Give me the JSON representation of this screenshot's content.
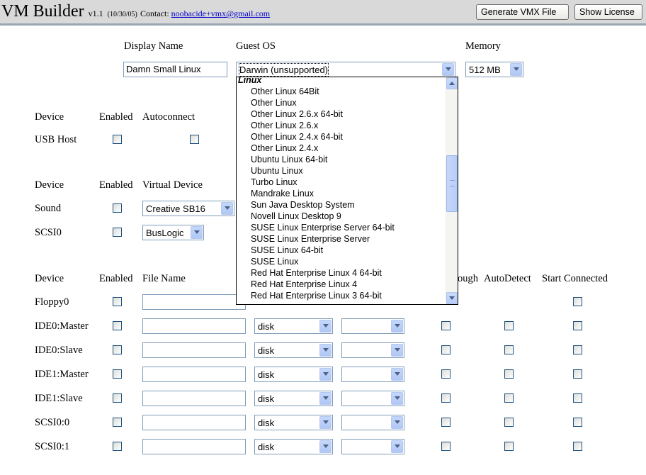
{
  "header": {
    "title": "VM Builder",
    "version": "v1.1",
    "date": "(10/30/05)",
    "contact_label": "Contact:",
    "contact_email": "noobacide+vmx@gmail.com",
    "generate_button": "Generate VMX File",
    "license_button": "Show License"
  },
  "general": {
    "display_name_label": "Display Name",
    "guest_os_label": "Guest OS",
    "memory_label": "Memory",
    "display_name_value": "Damn Small Linux",
    "guest_os_value": "Darwin (unsupported)",
    "memory_value": "512 MB"
  },
  "guest_os_dropdown": {
    "group": "Linux",
    "items": [
      "Other Linux 64Bit",
      "Other Linux",
      "Other Linux 2.6.x 64-bit",
      "Other Linux 2.6.x",
      "Other Linux 2.4.x 64-bit",
      "Other Linux 2.4.x",
      "Ubuntu Linux 64-bit",
      "Ubuntu Linux",
      "Turbo Linux",
      "Mandrake Linux",
      "Sun Java Desktop System",
      "Novell Linux Desktop 9",
      "SUSE Linux Enterprise Server 64-bit",
      "SUSE Linux Enterprise Server",
      "SUSE Linux 64-bit",
      "SUSE Linux",
      "Red Hat Enterprise Linux 4 64-bit",
      "Red Hat Enterprise Linux 4",
      "Red Hat Enterprise Linux 3 64-bit"
    ]
  },
  "usb_section": {
    "device_header": "Device",
    "enabled_header": "Enabled",
    "autoconnect_header": "Autoconnect",
    "row_label": "USB Host"
  },
  "virtual_section": {
    "device_header": "Device",
    "enabled_header": "Enabled",
    "virtual_device_header": "Virtual Device",
    "rows": [
      {
        "label": "Sound",
        "value": "Creative SB16"
      },
      {
        "label": "SCSI0",
        "value": "BusLogic"
      }
    ]
  },
  "storage_section": {
    "device_header": "Device",
    "enabled_header": "Enabled",
    "file_name_header": "File Name",
    "passthrough_header_partial": "ough",
    "autodetect_header": "AutoDetect",
    "start_connected_header": "Start Connected",
    "rows": [
      {
        "label": "Floppy0",
        "type": ""
      },
      {
        "label": "IDE0:Master",
        "type": "disk"
      },
      {
        "label": "IDE0:Slave",
        "type": "disk"
      },
      {
        "label": "IDE1:Master",
        "type": "disk"
      },
      {
        "label": "IDE1:Slave",
        "type": "disk"
      },
      {
        "label": "SCSI0:0",
        "type": "disk"
      },
      {
        "label": "SCSI0:1",
        "type": "disk"
      }
    ]
  }
}
